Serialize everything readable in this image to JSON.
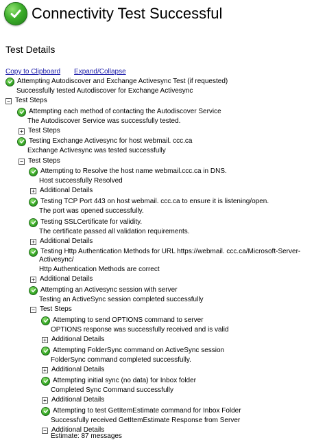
{
  "banner": {
    "title": "Connectivity Test Successful",
    "icon": "check-circle-icon"
  },
  "details": {
    "title": "Test Details",
    "copy_link": "Copy to Clipboard",
    "expand_link": "Expand/Collapse",
    "colors": {
      "success": "#3dae2b",
      "link": "#1a1aa8"
    }
  },
  "tree": [
    "Attempting Autodiscover and Exchange Activesync Test (if requested)",
    "Successfully tested Autodiscover for Exchange Activesync",
    "Test Steps",
    "Attempting each method of contacting the Autodiscover Service",
    "The Autodiscover Service was successfully tested.",
    "Test Steps",
    "Testing Exchange Activesync for host webmail. ccc.ca",
    "Exchange Activesync was tested successfully",
    "Test Steps",
    "Attempting to Resolve the host name webmail.ccc.ca in DNS.",
    "Host successfully Resolved",
    "Additional Details",
    "Testing TCP Port 443 on host webmail. ccc.ca to ensure it is listening/open.",
    "The port was opened successfully.",
    "Testing SSLCertificate for validity.",
    "The certificate passed all validation requirements.",
    "Additional Details",
    "Testing Http Authentication Methods for URL https://webmail. ccc.ca/Microsoft-Server-",
    "Activesync/",
    "Http Authentication Methods are correct",
    "Additional Details",
    "Attempting an Activesync session with server",
    "Testing an ActiveSync session completed successfully",
    "Test Steps",
    "Attempting to send OPTIONS command to server",
    "OPTIONS response was successfully received and is valid",
    "Additional Details",
    "Attempting FolderSync command on ActiveSync session",
    "FolderSync command completed successfully.",
    "Additional Details",
    "Attempting initial sync (no data) for Inbox folder",
    "Completed Sync Command successfully",
    "Additional Details",
    "Attempting to test GetItemEstimate command for Inbox Folder",
    "Successfully received GetItemEstimate Response from Server",
    "Additional Details",
    "Estimate: 87 messages"
  ]
}
